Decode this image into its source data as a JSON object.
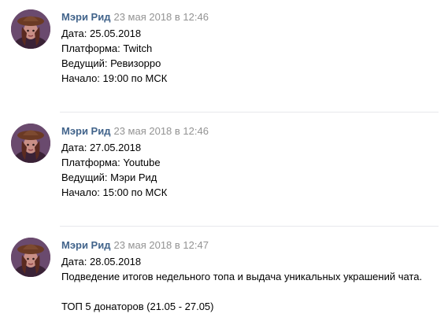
{
  "posts": [
    {
      "author": "Мэри Рид",
      "date": "23 мая 2018 в 12:46",
      "lines": [
        "Дата: 25.05.2018",
        "Платформа: Twitch",
        "Ведущий: Ревизорро",
        "Начало: 19:00 по МСК"
      ]
    },
    {
      "author": "Мэри Рид",
      "date": "23 мая 2018 в 12:46",
      "lines": [
        "Дата: 27.05.2018",
        "Платформа: Youtube",
        "Ведущий: Мэри Рид",
        "Начало: 15:00 по МСК"
      ]
    },
    {
      "author": "Мэри Рид",
      "date": "23 мая 2018 в 12:47",
      "lines": [
        "Дата: 28.05.2018",
        "Подведение итогов недельного топа и выдача уникальных украшений чата.",
        "",
        "ТОП 5 донаторов (21.05 - 27.05)"
      ]
    }
  ],
  "colors": {
    "author": "#42648b",
    "date": "#939393",
    "divider": "#e7e8ec"
  },
  "icons": {
    "avatar": "pirate-woman-avatar"
  }
}
